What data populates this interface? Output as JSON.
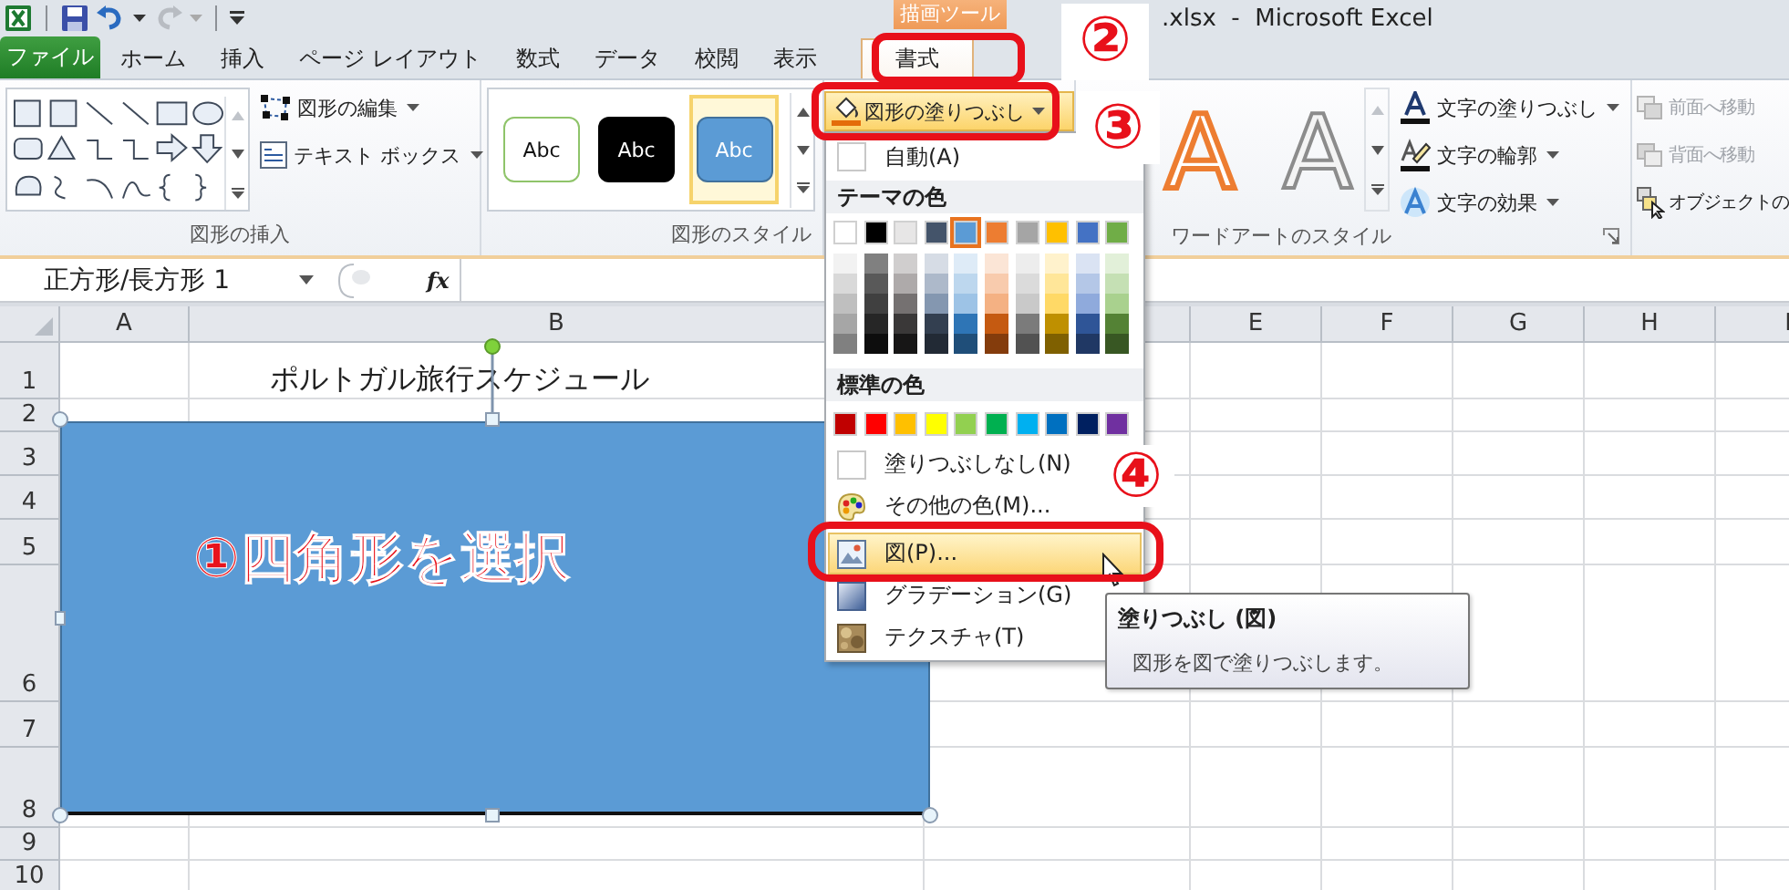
{
  "title_bar": {
    "window_title": ".xlsx  -  Microsoft Excel",
    "context_group": "描画ツール"
  },
  "tabs": [
    {
      "label": "ファイル",
      "kind": "file",
      "selected": false
    },
    {
      "label": "ホーム",
      "kind": "normal",
      "selected": false
    },
    {
      "label": "挿入",
      "kind": "normal",
      "selected": false
    },
    {
      "label": "ページ レイアウト",
      "kind": "normal",
      "selected": false
    },
    {
      "label": "数式",
      "kind": "normal",
      "selected": false
    },
    {
      "label": "データ",
      "kind": "normal",
      "selected": false
    },
    {
      "label": "校閲",
      "kind": "normal",
      "selected": false
    },
    {
      "label": "表示",
      "kind": "normal",
      "selected": false
    },
    {
      "label": "書式",
      "kind": "normal",
      "selected": true
    }
  ],
  "ribbon": {
    "insert_shapes": {
      "buttons": [
        {
          "label": "図形の編集",
          "kind": "edit"
        },
        {
          "label": "テキスト ボックス",
          "kind": "textbox"
        }
      ],
      "group_label": "図形の挿入"
    },
    "shape_styles": {
      "samples": [
        {
          "label": "Abc",
          "kind": "outline",
          "selected": false
        },
        {
          "label": "Abc",
          "kind": "dark",
          "selected": false
        },
        {
          "label": "Abc",
          "kind": "blue",
          "selected": true
        }
      ],
      "group_label": "図形のスタイル"
    },
    "fill_button": {
      "label": "図形の塗りつぶし",
      "open": true
    },
    "wordart": {
      "samples": [
        {
          "text": "A",
          "kind": "orange"
        },
        {
          "text": "A",
          "kind": "white"
        }
      ],
      "buttons": [
        {
          "label": "文字の塗りつぶし",
          "kind": "fill"
        },
        {
          "label": "文字の輪郭",
          "kind": "outline"
        },
        {
          "label": "文字の効果",
          "kind": "effects"
        }
      ],
      "group_label": "ワードアートのスタイル"
    },
    "arrange": {
      "buttons": [
        {
          "label": "前面へ移動",
          "kind": "forward",
          "disabled": true
        },
        {
          "label": "背面へ移動",
          "kind": "backward",
          "disabled": true
        },
        {
          "label": "オブジェクトの",
          "kind": "pane",
          "disabled": false
        }
      ]
    }
  },
  "formula_bar": {
    "name_box": "正方形/長方形 1",
    "fx": "fx"
  },
  "sheet": {
    "columns": [
      {
        "label": "A"
      },
      {
        "label": "B"
      },
      {
        "label": "E"
      },
      {
        "label": "F"
      },
      {
        "label": "G"
      },
      {
        "label": "H"
      },
      {
        "label": "I"
      }
    ],
    "rows": [
      {
        "number": "1",
        "cell_b": "ポルトガル旅行スケジュール"
      },
      {
        "number": "2"
      },
      {
        "number": "3"
      },
      {
        "number": "4"
      },
      {
        "number": "5"
      },
      {
        "number": "6"
      },
      {
        "number": "7"
      },
      {
        "number": "8"
      },
      {
        "number": "9"
      },
      {
        "number": "10"
      }
    ]
  },
  "shape": {
    "label": "①四角形を選択",
    "selected": true
  },
  "fill_menu": {
    "automatic": "自動(A)",
    "theme_heading": "テーマの色",
    "theme_colors": [
      {
        "color": "#ffffff",
        "selected": false,
        "shades": [
          {
            "color": "#f2f2f2"
          },
          {
            "color": "#d9d9d9"
          },
          {
            "color": "#bfbfbf"
          },
          {
            "color": "#a6a6a6"
          },
          {
            "color": "#808080"
          }
        ]
      },
      {
        "color": "#000000",
        "selected": false,
        "shades": [
          {
            "color": "#808080"
          },
          {
            "color": "#595959"
          },
          {
            "color": "#404040"
          },
          {
            "color": "#262626"
          },
          {
            "color": "#0d0d0d"
          }
        ]
      },
      {
        "color": "#e7e6e6",
        "selected": false,
        "shades": [
          {
            "color": "#d0cece"
          },
          {
            "color": "#aeaaaa"
          },
          {
            "color": "#757171"
          },
          {
            "color": "#3a3838"
          },
          {
            "color": "#171616"
          }
        ]
      },
      {
        "color": "#44546a",
        "selected": false,
        "shades": [
          {
            "color": "#d6dce5"
          },
          {
            "color": "#adb9ca"
          },
          {
            "color": "#8497b0"
          },
          {
            "color": "#333f50"
          },
          {
            "color": "#222a35"
          }
        ]
      },
      {
        "color": "#5b9bd5",
        "selected": true,
        "shades": [
          {
            "color": "#deebf7"
          },
          {
            "color": "#bdd7ee"
          },
          {
            "color": "#9dc3e6"
          },
          {
            "color": "#2e75b6"
          },
          {
            "color": "#1f4e79"
          }
        ]
      },
      {
        "color": "#ed7d31",
        "selected": false,
        "shades": [
          {
            "color": "#fbe5d6"
          },
          {
            "color": "#f8cbad"
          },
          {
            "color": "#f4b183"
          },
          {
            "color": "#c55a11"
          },
          {
            "color": "#843c0c"
          }
        ]
      },
      {
        "color": "#a5a5a5",
        "selected": false,
        "shades": [
          {
            "color": "#ededed"
          },
          {
            "color": "#dbdbdb"
          },
          {
            "color": "#c9c9c9"
          },
          {
            "color": "#7b7b7b"
          },
          {
            "color": "#525252"
          }
        ]
      },
      {
        "color": "#ffc000",
        "selected": false,
        "shades": [
          {
            "color": "#fff2cc"
          },
          {
            "color": "#ffe699"
          },
          {
            "color": "#ffd966"
          },
          {
            "color": "#bf9000"
          },
          {
            "color": "#7f6000"
          }
        ]
      },
      {
        "color": "#4472c4",
        "selected": false,
        "shades": [
          {
            "color": "#dae3f3"
          },
          {
            "color": "#b4c7e7"
          },
          {
            "color": "#8faadc"
          },
          {
            "color": "#2f5597"
          },
          {
            "color": "#203864"
          }
        ]
      },
      {
        "color": "#70ad47",
        "selected": false,
        "shades": [
          {
            "color": "#e2f0d9"
          },
          {
            "color": "#c5e0b4"
          },
          {
            "color": "#a9d18e"
          },
          {
            "color": "#548235"
          },
          {
            "color": "#385723"
          }
        ]
      }
    ],
    "standard_heading": "標準の色",
    "standard_colors": [
      {
        "color": "#c00000"
      },
      {
        "color": "#ff0000"
      },
      {
        "color": "#ffc000"
      },
      {
        "color": "#ffff00"
      },
      {
        "color": "#92d050"
      },
      {
        "color": "#00b050"
      },
      {
        "color": "#00b0f0"
      },
      {
        "color": "#0070c0"
      },
      {
        "color": "#002060"
      },
      {
        "color": "#7030a0"
      }
    ],
    "items": [
      {
        "label": "塗りつぶしなし(N)",
        "kind": "none",
        "selected": false
      },
      {
        "label": "その他の色(M)...",
        "kind": "more",
        "selected": false
      },
      {
        "label": "図(P)...",
        "kind": "picture",
        "selected": true
      },
      {
        "label": "グラデーション(G)",
        "kind": "gradient",
        "selected": false
      },
      {
        "label": "テクスチャ(T)",
        "kind": "texture",
        "selected": false
      }
    ]
  },
  "tooltip": {
    "title": "塗りつぶし (図)",
    "body": "図形を図で塗りつぶします。"
  },
  "annotations": [
    {
      "text": "②"
    },
    {
      "text": "③"
    },
    {
      "text": "④"
    }
  ]
}
